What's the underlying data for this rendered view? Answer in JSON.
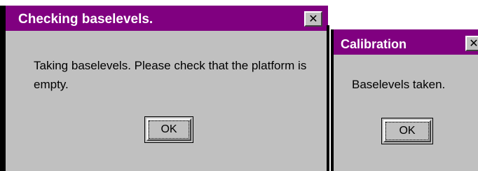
{
  "dialogs": [
    {
      "title": "Checking baselevels.",
      "close_glyph": "✕",
      "close_icon": "close-icon",
      "message": "Taking baselevels. Please check that the platform is empty.",
      "ok_label": "OK"
    },
    {
      "title": "Calibration",
      "close_glyph": "✕",
      "close_icon": "close-icon",
      "message": "Baselevels taken.",
      "ok_label": "OK"
    }
  ],
  "colors": {
    "titlebar": "#800080",
    "dialog_bg": "#c0c0c0",
    "title_text": "#ffffff"
  }
}
